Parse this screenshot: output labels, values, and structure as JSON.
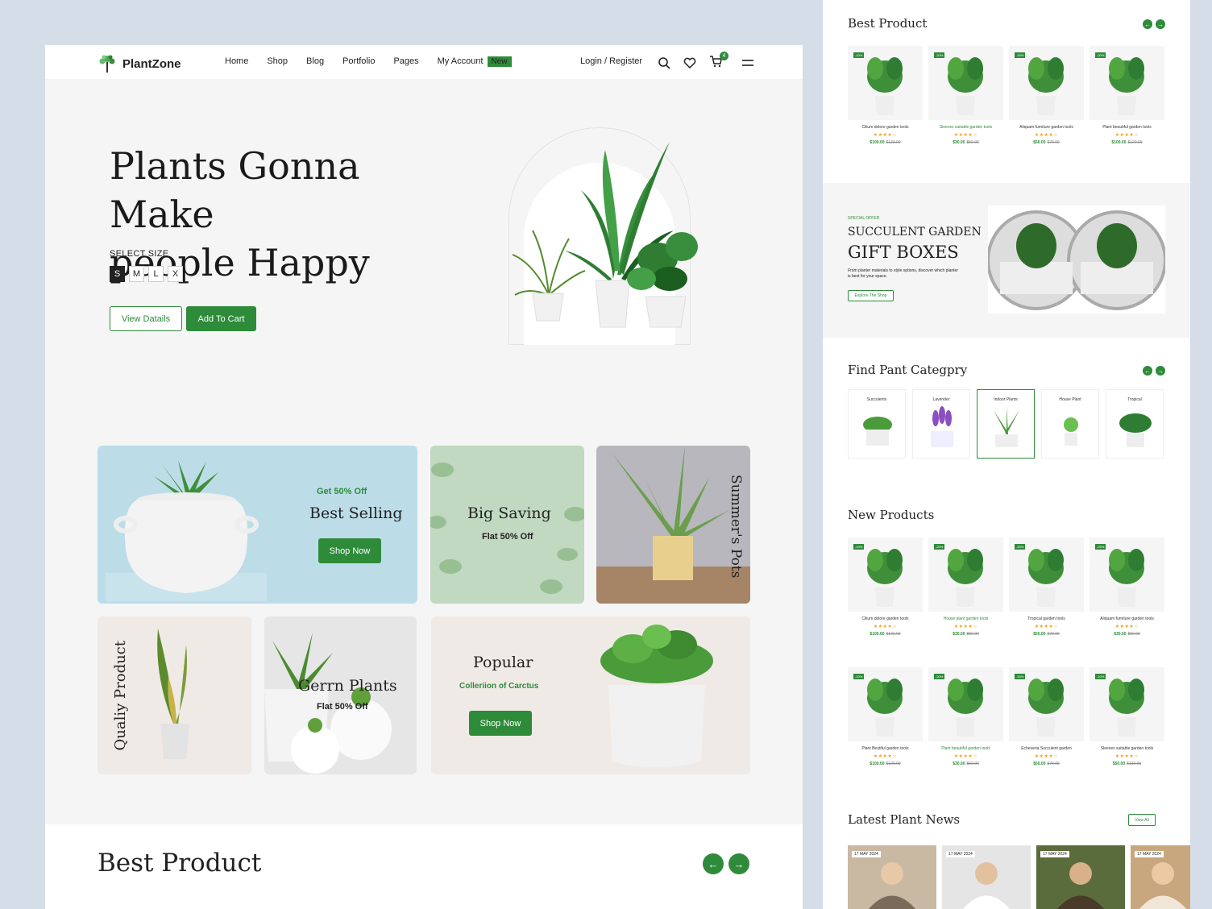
{
  "brand": {
    "name": "PlantZone",
    "accent": "#2e8b3a"
  },
  "nav": {
    "items": [
      "Home",
      "Shop",
      "Blog",
      "Portfolio",
      "Pages",
      "My Account"
    ],
    "new_badge": "New",
    "login": "Login / Register",
    "cart_count": "4",
    "icons": [
      "search-icon",
      "heart-icon",
      "cart-icon",
      "menu-icon"
    ]
  },
  "hero": {
    "title_line1": "Plants Gonna Make",
    "title_line2": "people Happy",
    "size_label": "SELECT SIZE",
    "sizes": [
      "S",
      "M",
      "L",
      "X"
    ],
    "selected_size": "S",
    "view_details": "View Datails",
    "add_to_cart": "Add To Cart"
  },
  "promos": {
    "best_selling": {
      "kicker": "Get 50% Off",
      "title": "Best Selling",
      "button": "Shop Now"
    },
    "big_saving": {
      "title": "Big Saving",
      "sub": "Flat 50% Off"
    },
    "summers_pots": {
      "title": "Summer's Pots"
    },
    "quality": {
      "title": "Qualiy Product"
    },
    "gerrn": {
      "title": "Gerrn Plants",
      "sub": "Flat 50% Off"
    },
    "popular": {
      "title": "Popular",
      "sub": "Colleriion of Carctus",
      "button": "Shop Now"
    }
  },
  "best_product_bottom": {
    "title": "Best Product"
  },
  "right": {
    "best_product": {
      "title": "Best Product",
      "items": [
        {
          "tag": "-10%",
          "name": "Cilium dolore garden tools",
          "stars": "★★★★☆",
          "price": "$100.00",
          "old": "$120.00"
        },
        {
          "tag": "-20%",
          "name": "Sleeves suitable garden tools",
          "stars": "★★★★☆",
          "price": "$30.00",
          "old": "$50.00"
        },
        {
          "tag": "-15%",
          "name": "Aliquam furniture garden tools",
          "stars": "★★★★☆",
          "price": "$50.00",
          "old": "$70.00"
        },
        {
          "tag": "-20%",
          "name": "Plant beautiful garden tools",
          "stars": "★★★★☆",
          "price": "$100.00",
          "old": "$120.00"
        }
      ]
    },
    "offer": {
      "kicker": "SPECIAL OFFER",
      "title1": "SUCCULENT GARDEN",
      "title2": "GIFT BOXES",
      "desc": "From planter materials to style options, discover which planter is best for your space.",
      "button": "Explore The Shop"
    },
    "category": {
      "title": "Find Pant Categpry",
      "items": [
        "Succulents",
        "Lavender",
        "Indoor Plants",
        "House Plant",
        "Tropical"
      ]
    },
    "new_products": {
      "title": "New Products",
      "items": [
        {
          "tag": "-10%",
          "name": "Cilium dolore garden tools",
          "stars": "★★★★☆",
          "price": "$100.00",
          "old": "$120.00"
        },
        {
          "tag": "-20%",
          "name": "House plant garden tools",
          "stars": "★★★★☆",
          "price": "$30.00",
          "old": "$50.00"
        },
        {
          "tag": "-15%",
          "name": "Tropical garden tools",
          "stars": "★★★★☆",
          "price": "$50.00",
          "old": "$70.00"
        },
        {
          "tag": "-25%",
          "name": "Aliquam furniture garden tools",
          "stars": "★★★★☆",
          "price": "$30.00",
          "old": "$50.00"
        },
        {
          "tag": "-10%",
          "name": "Plant Beutiful garden tools",
          "stars": "★★★★☆",
          "price": "$100.00",
          "old": "$120.00"
        },
        {
          "tag": "-20%",
          "name": "Plant beautiful garden tools",
          "stars": "★★★★☆",
          "price": "$30.00",
          "old": "$50.00"
        },
        {
          "tag": "-15%",
          "name": "Echeveria Succulent garden",
          "stars": "★★★★☆",
          "price": "$50.00",
          "old": "$70.00"
        },
        {
          "tag": "-10%",
          "name": "Sleeves suitable garden tools",
          "stars": "★★★★☆",
          "price": "$50.00",
          "old": "$120.00"
        }
      ]
    },
    "news": {
      "title": "Latest Plant News",
      "view_all": "View All",
      "dates": [
        "17 MAY 2024",
        "17 MAY 2024",
        "17 MAY 2024",
        "17 MAY 2024"
      ]
    }
  }
}
